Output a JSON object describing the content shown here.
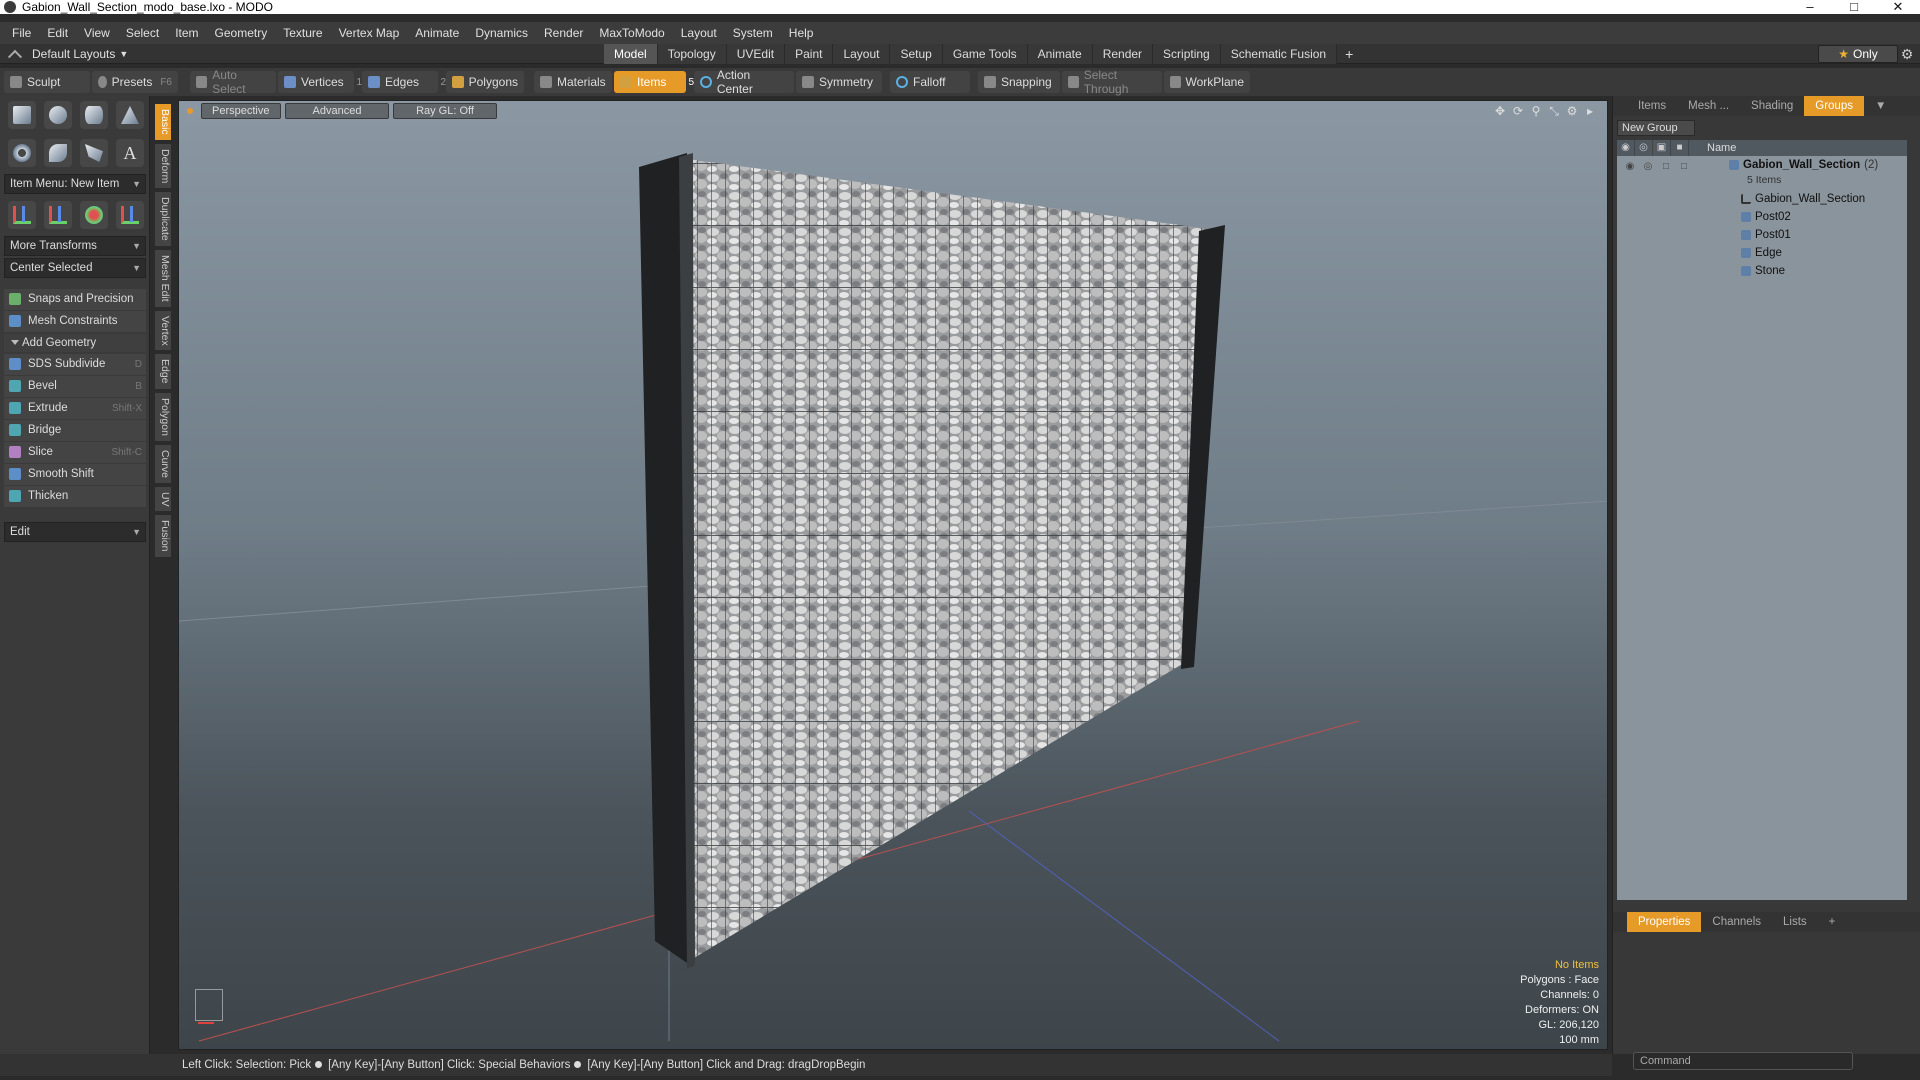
{
  "window": {
    "title": "Gabion_Wall_Section_modo_base.lxo - MODO"
  },
  "menu": [
    "File",
    "Edit",
    "View",
    "Select",
    "Item",
    "Geometry",
    "Texture",
    "Vertex Map",
    "Animate",
    "Dynamics",
    "Render",
    "MaxToModo",
    "Layout",
    "System",
    "Help"
  ],
  "layout": {
    "default_label": "Default Layouts",
    "tabs": [
      "Model",
      "Topology",
      "UVEdit",
      "Paint",
      "Layout",
      "Setup",
      "Game Tools",
      "Animate",
      "Render",
      "Scripting",
      "Schematic Fusion"
    ],
    "active_tab": "Model",
    "only_label": "Only"
  },
  "toolbar": {
    "sculpt": "Sculpt",
    "presets": "Presets",
    "presets_key": "F6",
    "auto_select": "Auto Select",
    "vertices": "Vertices",
    "vertices_count": "1",
    "edges": "Edges",
    "edges_count": "2",
    "polygons": "Polygons",
    "materials": "Materials",
    "items": "Items",
    "items_count": "5",
    "action_center": "Action Center",
    "symmetry": "Symmetry",
    "falloff": "Falloff",
    "snapping": "Snapping",
    "select_through": "Select Through",
    "workplane": "WorkPlane"
  },
  "left_panel": {
    "item_menu": "Item Menu: New Item",
    "more_transforms": "More Transforms",
    "center_selected": "Center Selected",
    "snaps": "Snaps and Precision",
    "mesh_constraints": "Mesh Constraints",
    "add_geometry": "Add Geometry",
    "tools": [
      {
        "label": "SDS Subdivide",
        "key": "D"
      },
      {
        "label": "Bevel",
        "key": "B"
      },
      {
        "label": "Extrude",
        "key": "Shift-X"
      },
      {
        "label": "Bridge",
        "key": ""
      },
      {
        "label": "Slice",
        "key": "Shift-C"
      },
      {
        "label": "Smooth Shift",
        "key": ""
      },
      {
        "label": "Thicken",
        "key": ""
      }
    ],
    "edit_dropdown": "Edit",
    "vertical_tabs": [
      "Basic",
      "Deform",
      "Duplicate",
      "Mesh Edit",
      "Vertex",
      "Edge",
      "Polygon",
      "Curve",
      "UV",
      "Fusion"
    ]
  },
  "viewport": {
    "buttons": [
      "Perspective",
      "Advanced",
      "Ray GL: Off"
    ],
    "info": {
      "no_items": "No Items",
      "polygons": "Polygons : Face",
      "channels": "Channels: 0",
      "deformers": "Deformers: ON",
      "gl": "GL: 206,120",
      "unit": "100 mm"
    }
  },
  "right_panel": {
    "tabs": [
      "Items",
      "Mesh ...",
      "Shading",
      "Groups"
    ],
    "active_tab": "Groups",
    "new_group": "New Group",
    "name_col": "Name",
    "group_name": "Gabion_Wall_Section",
    "group_count": "(2)",
    "group_sub": "5 Items",
    "children": [
      "Gabion_Wall_Section",
      "Post02",
      "Post01",
      "Edge",
      "Stone"
    ],
    "bottom_tabs": [
      "Properties",
      "Channels",
      "Lists"
    ],
    "bottom_active": "Properties",
    "command_placeholder": "Command"
  },
  "statusbar": {
    "seg1": "Left Click: Selection: Pick",
    "seg2": "[Any Key]-[Any Button] Click: Special Behaviors",
    "seg3": "[Any Key]-[Any Button] Click and Drag: dragDropBegin"
  }
}
